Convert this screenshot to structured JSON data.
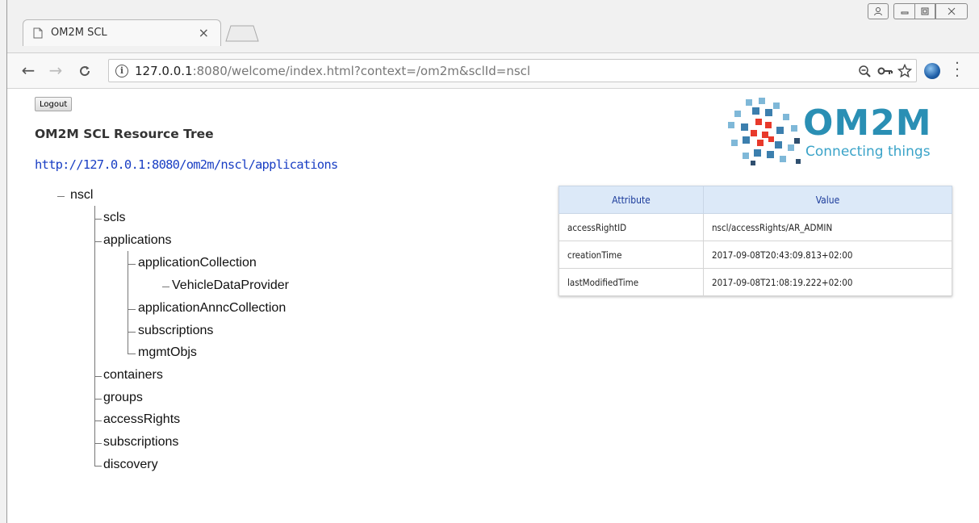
{
  "browser": {
    "tab_title": "OM2M SCL",
    "tab_close": "×",
    "url_host": "127.0.0.1",
    "url_rest": ":8080/welcome/index.html?context=/om2m&sclId=nscl"
  },
  "page": {
    "logout_label": "Logout",
    "title": "OM2M SCL Resource Tree",
    "resource_url": "http://127.0.0.1:8080/om2m/nscl/applications"
  },
  "logo": {
    "name": "OM2M",
    "tagline": "Connecting things"
  },
  "tree": {
    "root": "nscl",
    "scls": "scls",
    "applications": "applications",
    "applicationCollection": "applicationCollection",
    "vehicleDataProvider": "VehicleDataProvider",
    "applicationAnncCollection": "applicationAnncCollection",
    "app_subscriptions": "subscriptions",
    "mgmtObjs": "mgmtObjs",
    "containers": "containers",
    "groups": "groups",
    "accessRights": "accessRights",
    "subscriptions": "subscriptions",
    "discovery": "discovery"
  },
  "attributes": {
    "header_attribute": "Attribute",
    "header_value": "Value",
    "rows": [
      {
        "name": "accessRightID",
        "value": "nscl/accessRights/AR_ADMIN"
      },
      {
        "name": "creationTime",
        "value": "2017-09-08T20:43:09.813+02:00"
      },
      {
        "name": "lastModifiedTime",
        "value": "2017-09-08T21:08:19.222+02:00"
      }
    ]
  }
}
